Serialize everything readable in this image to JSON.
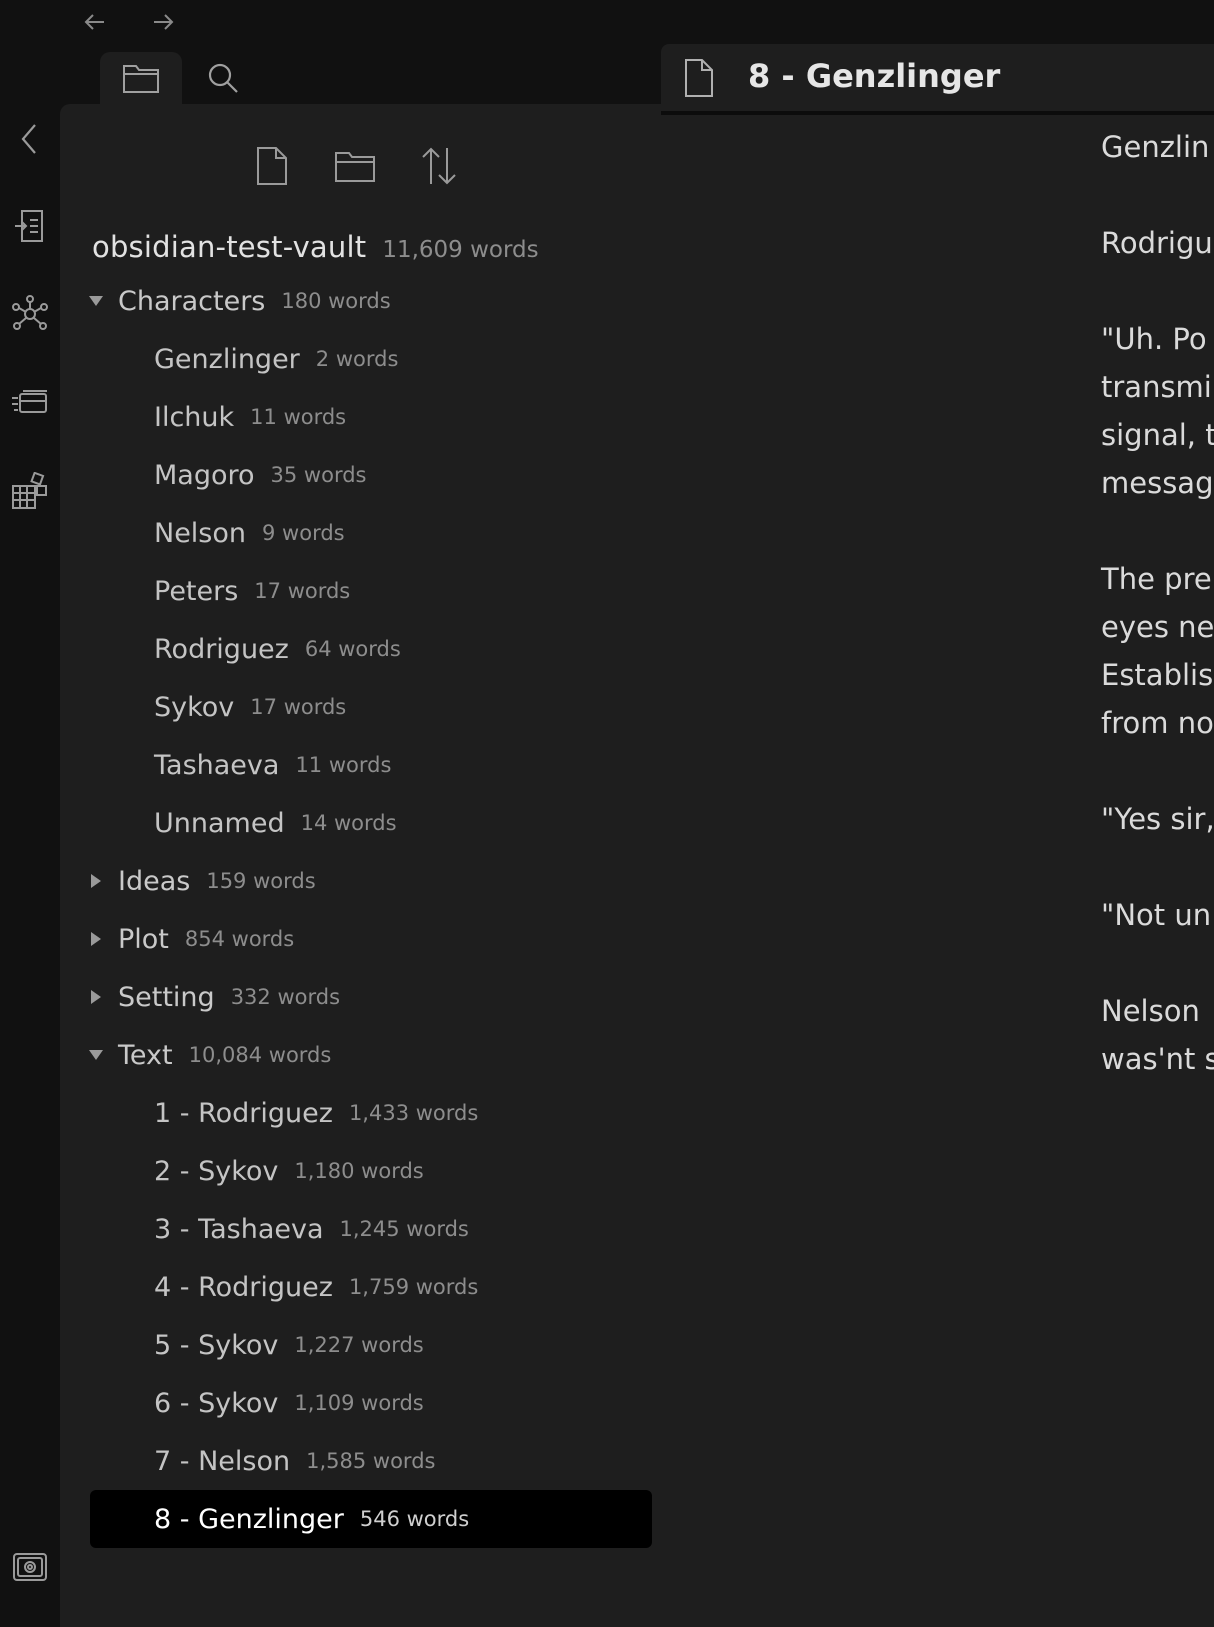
{
  "nav": {
    "back_icon": "arrow-left-icon",
    "forward_icon": "arrow-right-icon"
  },
  "ribbon": {
    "collapse_icon": "chevron-left-icon",
    "items": [
      {
        "name": "ribbon-command-palette",
        "icon": "command-palette-icon"
      },
      {
        "name": "ribbon-graph-view",
        "icon": "graph-icon"
      },
      {
        "name": "ribbon-slides",
        "icon": "slides-icon"
      },
      {
        "name": "ribbon-canvas",
        "icon": "canvas-icon"
      }
    ],
    "bottom_icon": "vault-icon"
  },
  "sidebar_tabs": [
    {
      "name": "file-explorer-tab",
      "icon": "folder-icon",
      "active": true
    },
    {
      "name": "search-tab",
      "icon": "search-icon",
      "active": false
    }
  ],
  "explorer_actions": [
    {
      "name": "new-note-button",
      "icon": "new-note-icon"
    },
    {
      "name": "new-folder-button",
      "icon": "new-folder-icon"
    },
    {
      "name": "sort-button",
      "icon": "sort-icon"
    }
  ],
  "vault": {
    "name": "obsidian-test-vault",
    "word_count": "11,609 words"
  },
  "tree": [
    {
      "name": "Characters",
      "word_count": "180 words",
      "expanded": true,
      "files": [
        {
          "name": "Genzlinger",
          "word_count": "2 words"
        },
        {
          "name": "Ilchuk",
          "word_count": "11 words"
        },
        {
          "name": "Magoro",
          "word_count": "35 words"
        },
        {
          "name": "Nelson",
          "word_count": "9 words"
        },
        {
          "name": "Peters",
          "word_count": "17 words"
        },
        {
          "name": "Rodriguez",
          "word_count": "64 words"
        },
        {
          "name": "Sykov",
          "word_count": "17 words"
        },
        {
          "name": "Tashaeva",
          "word_count": "11 words"
        },
        {
          "name": "Unnamed",
          "word_count": "14 words"
        }
      ]
    },
    {
      "name": "Ideas",
      "word_count": "159 words",
      "expanded": false,
      "files": []
    },
    {
      "name": "Plot",
      "word_count": "854 words",
      "expanded": false,
      "files": []
    },
    {
      "name": "Setting",
      "word_count": "332 words",
      "expanded": false,
      "files": []
    },
    {
      "name": "Text",
      "word_count": "10,084 words",
      "expanded": true,
      "files": [
        {
          "name": "1 - Rodriguez",
          "word_count": "1,433 words"
        },
        {
          "name": "2 - Sykov",
          "word_count": "1,180 words"
        },
        {
          "name": "3 - Tashaeva",
          "word_count": "1,245 words"
        },
        {
          "name": "4 - Rodriguez",
          "word_count": "1,759 words"
        },
        {
          "name": "5 - Sykov",
          "word_count": "1,227 words"
        },
        {
          "name": "6 - Sykov",
          "word_count": "1,109 words"
        },
        {
          "name": "7 - Nelson",
          "word_count": "1,585 words"
        },
        {
          "name": "8 - Genzlinger",
          "word_count": "546 words",
          "active": true
        }
      ]
    }
  ],
  "tab": {
    "title": "8 - Genzlinger",
    "icon": "document-icon"
  },
  "editor": {
    "paragraphs": [
      [
        "Genzlin"
      ],
      [
        "Rodrigu"
      ],
      [
        "\"Uh. Po",
        "transmi",
        "signal, t",
        "messag"
      ],
      [
        "The pre",
        "eyes ne",
        "Establis",
        "from no"
      ],
      [
        "\"Yes sir,"
      ],
      [
        "\"Not un"
      ],
      [
        "Nelson ",
        "was'nt s"
      ]
    ]
  },
  "colors": {
    "background": "#111111",
    "panel": "#1e1e1e",
    "active_row": "#000000"
  }
}
